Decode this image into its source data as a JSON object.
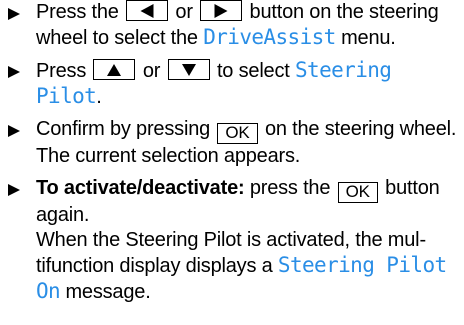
{
  "instructions": {
    "step1": {
      "t1": "Press the",
      "t2": "or",
      "t3": "button on the steering wheel to select the",
      "menu": "DriveAssist",
      "t4": "menu.",
      "key_left_icon": "triangle-left",
      "key_right_icon": "triangle-right"
    },
    "step2": {
      "t1": "Press",
      "t2": "or",
      "t3": "to select",
      "item": "Steering Pilot",
      "t4": ".",
      "key_up_icon": "triangle-up",
      "key_down_icon": "triangle-down"
    },
    "step3": {
      "t1": "Confirm by pressing",
      "key_ok": "OK",
      "t2": "on the steering wheel.",
      "result": "The current selection appears."
    },
    "step4": {
      "bold": "To activate/deactivate:",
      "t1": "press the",
      "key_ok": "OK",
      "t2": "but­ton again.",
      "result1": "When the Steering Pilot is activated, the mul­tifunction display displays a",
      "message": "Steering Pilot On",
      "result2": "message."
    }
  },
  "colors": {
    "display_text": "#2a8ee6",
    "text": "#000000",
    "background": "#ffffff"
  }
}
